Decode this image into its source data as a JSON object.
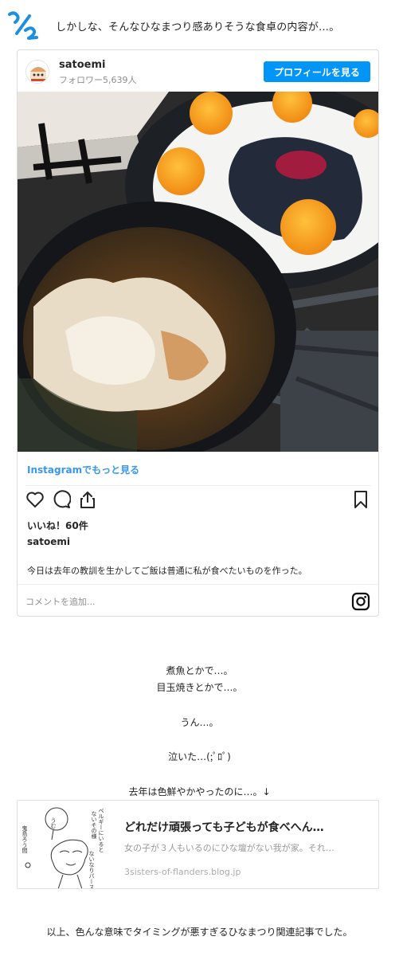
{
  "intro": {
    "page_mark": "1/2",
    "text": "しかしな、そんなひなまつり感ありそうな食卓の内容が…。"
  },
  "instagram": {
    "username": "satoemi",
    "followers": "フォロワー5,639人",
    "profile_button": "プロフィールを見る",
    "more_link": "Instagramでもっと見る",
    "likes": "いいね！60件",
    "owner": "satoemi",
    "caption": "今日は去年の教訓を生かしてご飯は普通に私が食べたいものを作った。",
    "comment_placeholder": "コメントを追加...",
    "icons": [
      "heart-icon",
      "comment-icon",
      "share-icon",
      "bookmark-icon",
      "instagram-logo-icon"
    ]
  },
  "body_lines": {
    "l1": "煮魚とかで…。",
    "l2": "目玉焼きとかで…。",
    "l3": "うん…。",
    "l4": "泣いた…(;ﾟﾛﾟ)",
    "l5": "去年は色鮮やかやったのに…。↓"
  },
  "link_card": {
    "title": "どれだけ頑張っても子どもが食べへん…",
    "description": "女の子が３人もいるのにひな壇がない我が家。それ…",
    "domain": "3sisters-of-flanders.blog.jp",
    "thumb_texts": {
      "bubble": "うむ",
      "right": "ベルギーにいると",
      "right2": "ないその様",
      "left": "鬼島ろう間",
      "bottom": "ないなりパース"
    }
  },
  "outro": "以上、色んな意味でタイミングが悪すぎるひなまつり関連記事でした。"
}
